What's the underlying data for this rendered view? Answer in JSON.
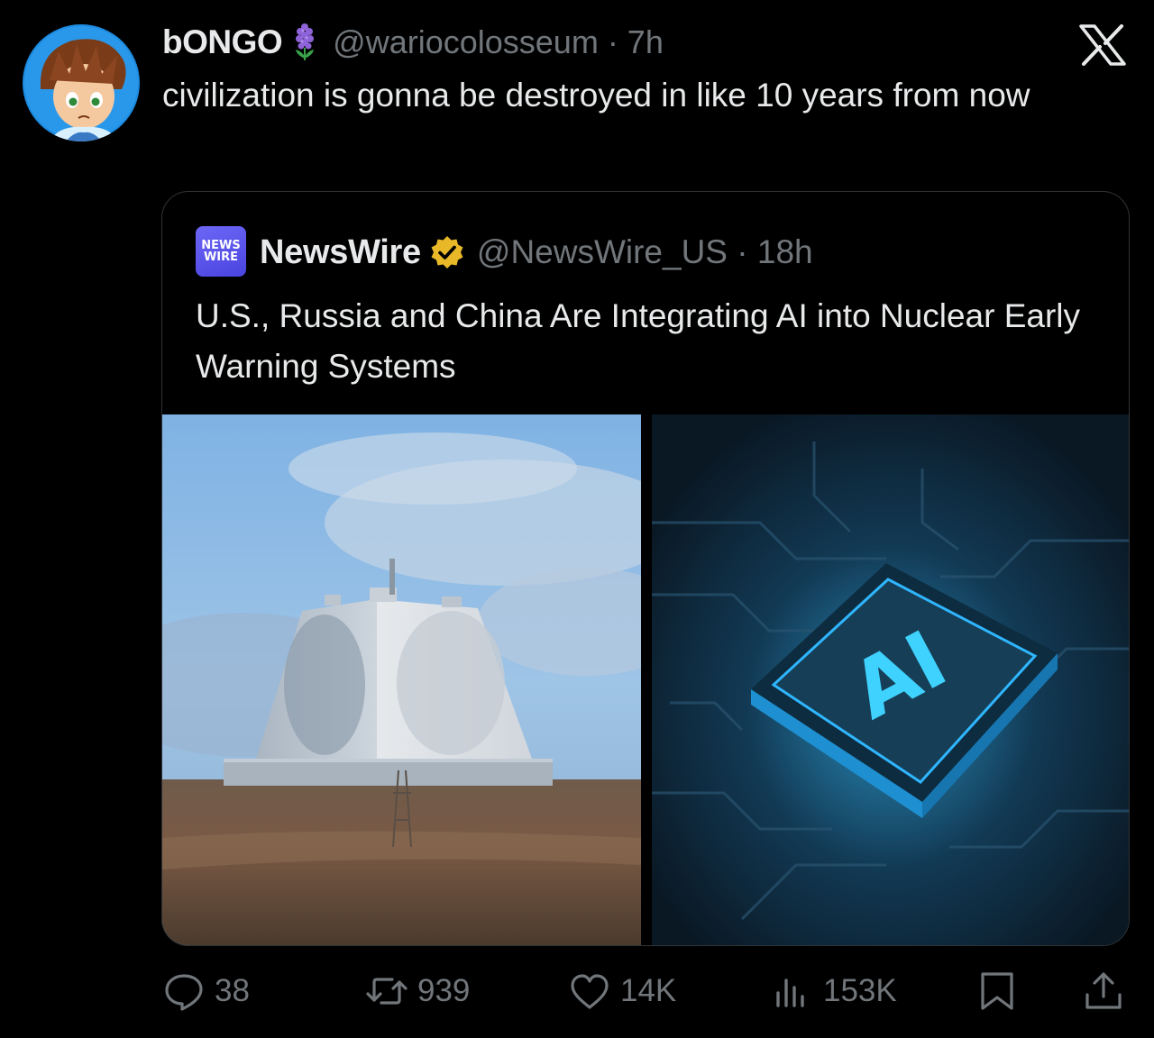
{
  "tweet": {
    "display_name": "bONGO",
    "name_emoji_icon": "hyacinth-flower-icon",
    "handle_time": "@wariocolosseum · 7h",
    "text": "civilization is gonna be destroyed in like 10 years from now"
  },
  "app_logo_icon": "x-logo-icon",
  "quoted": {
    "avatar_line1": "NEWS",
    "avatar_line2": "WIRE",
    "display_name": "NewsWire",
    "badge_icon": "gold-verified-badge-icon",
    "handle_time": "@NewsWire_US · 18h",
    "text": "U.S., Russia and China Are Integrating AI into Nuclear Early Warning Systems",
    "images": [
      {
        "description_icon": "radar-station-photo"
      },
      {
        "description_icon": "ai-chip-photo",
        "overlay_text": "AI"
      }
    ]
  },
  "actions": {
    "replies": "38",
    "reposts": "939",
    "likes": "14K",
    "views": "153K"
  },
  "colors": {
    "background": "#000000",
    "text": "#e7e9ea",
    "secondary": "#71767b",
    "verified_gold": "#e8b829",
    "newswire_purple": "#5a54ec"
  }
}
